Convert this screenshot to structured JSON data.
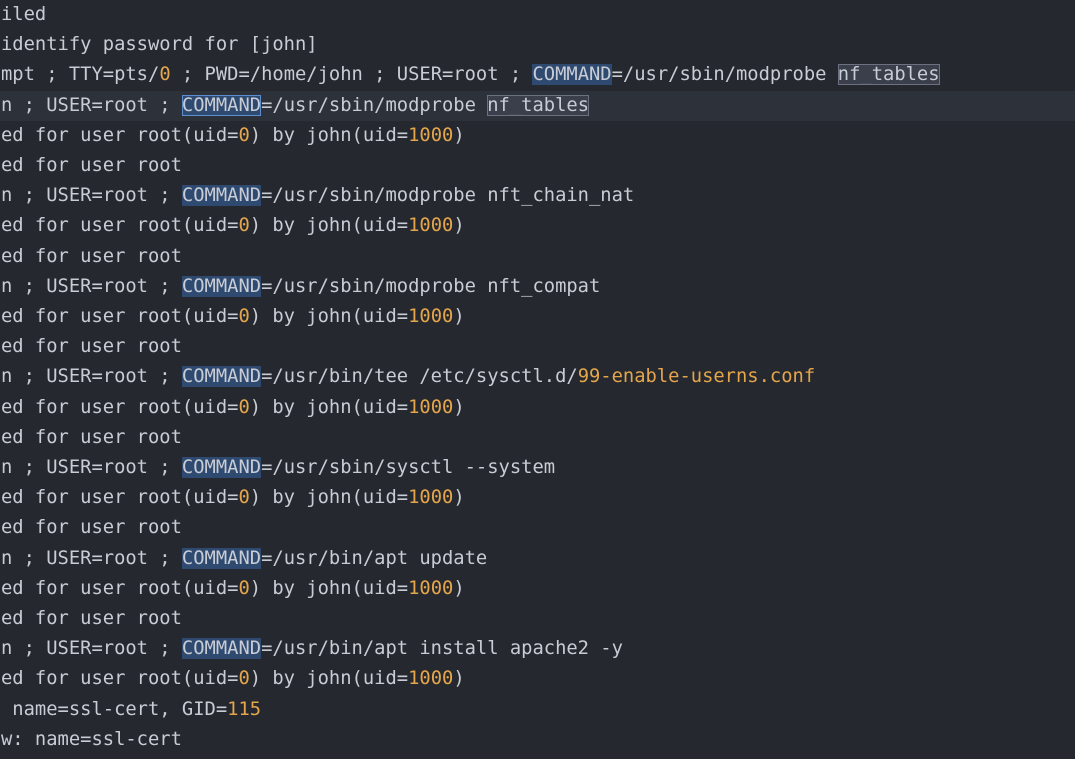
{
  "editor": {
    "lines": [
      {
        "segments": [
          {
            "t": "iled",
            "c": "plain"
          }
        ]
      },
      {
        "segments": [
          {
            "t": "identify password for [john]",
            "c": "plain"
          }
        ]
      },
      {
        "segments": [
          {
            "t": "mpt ; TTY=pts/",
            "c": "plain"
          },
          {
            "t": "0",
            "c": "num"
          },
          {
            "t": " ; PWD=/home/john ; USER=root ; ",
            "c": "plain"
          },
          {
            "t": "COMMAND",
            "c": "kw"
          },
          {
            "t": "=/usr/sbin/modprobe ",
            "c": "plain"
          },
          {
            "t": "nf_tables",
            "c": "match"
          }
        ]
      },
      {
        "current": true,
        "segments": [
          {
            "t": "n ; USER=root ; ",
            "c": "plain"
          },
          {
            "t": "COMMAND",
            "c": "kw active"
          },
          {
            "t": "=/usr/sbin/modprobe ",
            "c": "plain"
          },
          {
            "t": "nf_tables",
            "c": "match"
          }
        ]
      },
      {
        "segments": [
          {
            "t": "ed for user root(uid=",
            "c": "plain"
          },
          {
            "t": "0",
            "c": "num"
          },
          {
            "t": ") by john(uid=",
            "c": "plain"
          },
          {
            "t": "1000",
            "c": "num"
          },
          {
            "t": ")",
            "c": "plain"
          }
        ]
      },
      {
        "segments": [
          {
            "t": "ed for user root",
            "c": "plain"
          }
        ]
      },
      {
        "segments": [
          {
            "t": "n ; USER=root ; ",
            "c": "plain"
          },
          {
            "t": "COMMAND",
            "c": "kw"
          },
          {
            "t": "=/usr/sbin/modprobe nft_chain_nat",
            "c": "plain"
          }
        ]
      },
      {
        "segments": [
          {
            "t": "ed for user root(uid=",
            "c": "plain"
          },
          {
            "t": "0",
            "c": "num"
          },
          {
            "t": ") by john(uid=",
            "c": "plain"
          },
          {
            "t": "1000",
            "c": "num"
          },
          {
            "t": ")",
            "c": "plain"
          }
        ]
      },
      {
        "segments": [
          {
            "t": "ed for user root",
            "c": "plain"
          }
        ]
      },
      {
        "segments": [
          {
            "t": "n ; USER=root ; ",
            "c": "plain"
          },
          {
            "t": "COMMAND",
            "c": "kw"
          },
          {
            "t": "=/usr/sbin/modprobe nft_compat",
            "c": "plain"
          }
        ]
      },
      {
        "segments": [
          {
            "t": "ed for user root(uid=",
            "c": "plain"
          },
          {
            "t": "0",
            "c": "num"
          },
          {
            "t": ") by john(uid=",
            "c": "plain"
          },
          {
            "t": "1000",
            "c": "num"
          },
          {
            "t": ")",
            "c": "plain"
          }
        ]
      },
      {
        "segments": [
          {
            "t": "ed for user root",
            "c": "plain"
          }
        ]
      },
      {
        "segments": [
          {
            "t": "n ; USER=root ; ",
            "c": "plain"
          },
          {
            "t": "COMMAND",
            "c": "kw"
          },
          {
            "t": "=/usr/bin/tee /etc/sysctl.d/",
            "c": "plain"
          },
          {
            "t": "99-enable-userns.conf",
            "c": "num"
          }
        ]
      },
      {
        "segments": [
          {
            "t": "ed for user root(uid=",
            "c": "plain"
          },
          {
            "t": "0",
            "c": "num"
          },
          {
            "t": ") by john(uid=",
            "c": "plain"
          },
          {
            "t": "1000",
            "c": "num"
          },
          {
            "t": ")",
            "c": "plain"
          }
        ]
      },
      {
        "segments": [
          {
            "t": "ed for user root",
            "c": "plain"
          }
        ]
      },
      {
        "segments": [
          {
            "t": "n ; USER=root ; ",
            "c": "plain"
          },
          {
            "t": "COMMAND",
            "c": "kw"
          },
          {
            "t": "=/usr/sbin/sysctl --system",
            "c": "plain"
          }
        ]
      },
      {
        "segments": [
          {
            "t": "ed for user root(uid=",
            "c": "plain"
          },
          {
            "t": "0",
            "c": "num"
          },
          {
            "t": ") by john(uid=",
            "c": "plain"
          },
          {
            "t": "1000",
            "c": "num"
          },
          {
            "t": ")",
            "c": "plain"
          }
        ]
      },
      {
        "segments": [
          {
            "t": "ed for user root",
            "c": "plain"
          }
        ]
      },
      {
        "segments": [
          {
            "t": "n ; USER=root ; ",
            "c": "plain"
          },
          {
            "t": "COMMAND",
            "c": "kw"
          },
          {
            "t": "=/usr/bin/apt update",
            "c": "plain"
          }
        ]
      },
      {
        "segments": [
          {
            "t": "ed for user root(uid=",
            "c": "plain"
          },
          {
            "t": "0",
            "c": "num"
          },
          {
            "t": ") by john(uid=",
            "c": "plain"
          },
          {
            "t": "1000",
            "c": "num"
          },
          {
            "t": ")",
            "c": "plain"
          }
        ]
      },
      {
        "segments": [
          {
            "t": "ed for user root",
            "c": "plain"
          }
        ]
      },
      {
        "segments": [
          {
            "t": "n ; USER=root ; ",
            "c": "plain"
          },
          {
            "t": "COMMAND",
            "c": "kw"
          },
          {
            "t": "=/usr/bin/apt install apache2 -y",
            "c": "plain"
          }
        ]
      },
      {
        "segments": [
          {
            "t": "ed for user root(uid=",
            "c": "plain"
          },
          {
            "t": "0",
            "c": "num"
          },
          {
            "t": ") by john(uid=",
            "c": "plain"
          },
          {
            "t": "1000",
            "c": "num"
          },
          {
            "t": ")",
            "c": "plain"
          }
        ]
      },
      {
        "segments": [
          {
            "t": " name=ssl-cert, GID=",
            "c": "plain"
          },
          {
            "t": "115",
            "c": "num"
          }
        ]
      },
      {
        "segments": [
          {
            "t": "w: name=ssl-cert",
            "c": "plain"
          }
        ]
      }
    ]
  },
  "colors": {
    "background": "#25282e",
    "text": "#c8ccd4",
    "number": "#e5a64b",
    "keyword_highlight": "#2f4a70",
    "match_highlight": "#3a3f4b",
    "current_line": "#2c313a"
  }
}
